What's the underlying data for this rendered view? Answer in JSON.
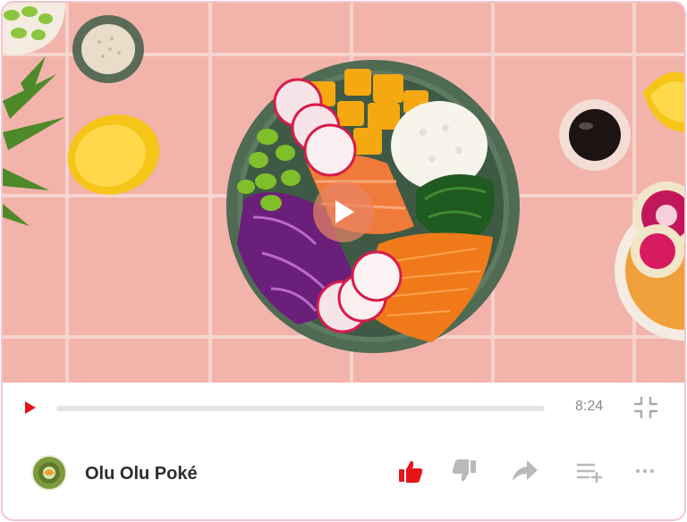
{
  "video": {
    "play_state": "paused",
    "duration_label": "8:24",
    "progress": 0.0
  },
  "icons": {
    "center_play": "play-icon",
    "control_play": "play-icon",
    "fullscreen": "exit-fullscreen-icon",
    "like": "thumbs-up-icon",
    "dislike": "thumbs-down-icon",
    "share": "share-icon",
    "add_to_playlist": "playlist-add-icon",
    "more": "more-icon"
  },
  "channel": {
    "name": "Olu Olu Poké",
    "avatar_text": "OLU POKÉ"
  },
  "actions": {
    "liked": true
  },
  "colors": {
    "accent_red": "#e7141a",
    "border_pink": "#f3c6cf",
    "tile_pink": "#f2b4ac",
    "icon_gray": "#b9b9b9"
  }
}
